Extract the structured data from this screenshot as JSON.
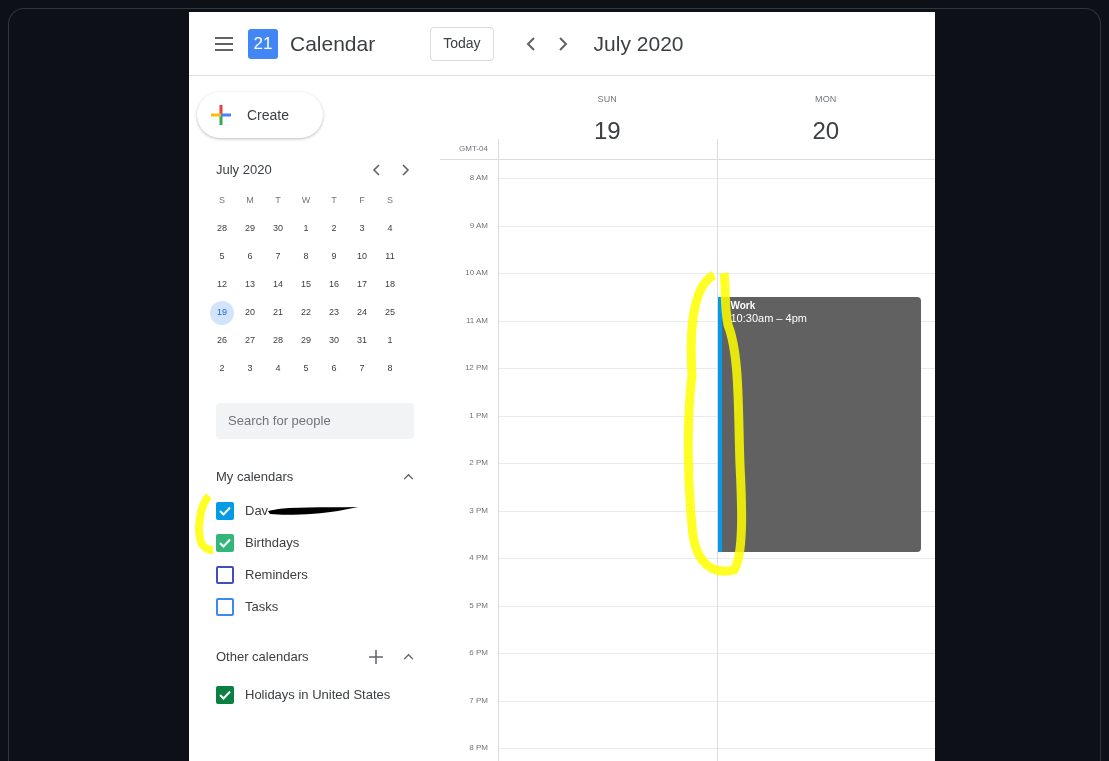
{
  "header": {
    "logo_day": "21",
    "app_title": "Calendar",
    "today_button": "Today",
    "period": "July 2020"
  },
  "sidebar": {
    "create_button": "Create",
    "mini_calendar": {
      "title": "July 2020",
      "weekdays": [
        "S",
        "M",
        "T",
        "W",
        "T",
        "F",
        "S"
      ],
      "weeks": [
        [
          {
            "label": "28",
            "selected": false
          },
          {
            "label": "29",
            "selected": false
          },
          {
            "label": "30",
            "selected": false
          },
          {
            "label": "1",
            "selected": false
          },
          {
            "label": "2",
            "selected": false
          },
          {
            "label": "3",
            "selected": false
          },
          {
            "label": "4",
            "selected": false
          }
        ],
        [
          {
            "label": "5",
            "selected": false
          },
          {
            "label": "6",
            "selected": false
          },
          {
            "label": "7",
            "selected": false
          },
          {
            "label": "8",
            "selected": false
          },
          {
            "label": "9",
            "selected": false
          },
          {
            "label": "10",
            "selected": false
          },
          {
            "label": "11",
            "selected": false
          }
        ],
        [
          {
            "label": "12",
            "selected": false
          },
          {
            "label": "13",
            "selected": false
          },
          {
            "label": "14",
            "selected": false
          },
          {
            "label": "15",
            "selected": false
          },
          {
            "label": "16",
            "selected": false
          },
          {
            "label": "17",
            "selected": false
          },
          {
            "label": "18",
            "selected": false
          }
        ],
        [
          {
            "label": "19",
            "selected": true
          },
          {
            "label": "20",
            "selected": false
          },
          {
            "label": "21",
            "selected": false
          },
          {
            "label": "22",
            "selected": false
          },
          {
            "label": "23",
            "selected": false
          },
          {
            "label": "24",
            "selected": false
          },
          {
            "label": "25",
            "selected": false
          }
        ],
        [
          {
            "label": "26",
            "selected": false
          },
          {
            "label": "27",
            "selected": false
          },
          {
            "label": "28",
            "selected": false
          },
          {
            "label": "29",
            "selected": false
          },
          {
            "label": "30",
            "selected": false
          },
          {
            "label": "31",
            "selected": false
          },
          {
            "label": "1",
            "selected": false
          }
        ],
        [
          {
            "label": "2",
            "selected": false
          },
          {
            "label": "3",
            "selected": false
          },
          {
            "label": "4",
            "selected": false
          },
          {
            "label": "5",
            "selected": false
          },
          {
            "label": "6",
            "selected": false
          },
          {
            "label": "7",
            "selected": false
          },
          {
            "label": "8",
            "selected": false
          }
        ]
      ]
    },
    "search": {
      "placeholder": "Search for people"
    },
    "sections": [
      {
        "title": "My calendars",
        "expanded": true,
        "add_button": false,
        "items": [
          {
            "label": "Dav",
            "checked": true,
            "color": "#039be5",
            "redacted": true
          },
          {
            "label": "Birthdays",
            "checked": true,
            "color": "#33b679",
            "redacted": false
          },
          {
            "label": "Reminders",
            "checked": false,
            "color": "#3f51b5",
            "redacted": false
          },
          {
            "label": "Tasks",
            "checked": false,
            "color": "#4285f4",
            "redacted": false
          }
        ]
      },
      {
        "title": "Other calendars",
        "expanded": true,
        "add_button": true,
        "items": [
          {
            "label": "Holidays in United States",
            "checked": true,
            "color": "#0b8043",
            "redacted": false
          }
        ]
      }
    ]
  },
  "grid": {
    "timezone": "GMT-04",
    "hours": [
      "8 AM",
      "9 AM",
      "10 AM",
      "11 AM",
      "12 PM",
      "1 PM",
      "2 PM",
      "3 PM",
      "4 PM",
      "5 PM",
      "6 PM",
      "7 PM",
      "8 PM"
    ],
    "days": [
      {
        "weekday": "SUN",
        "date": "19"
      },
      {
        "weekday": "MON",
        "date": "20",
        "events": [
          {
            "title": "Work",
            "time": "10:30am – 4pm",
            "color": "#039be5"
          }
        ]
      }
    ]
  }
}
